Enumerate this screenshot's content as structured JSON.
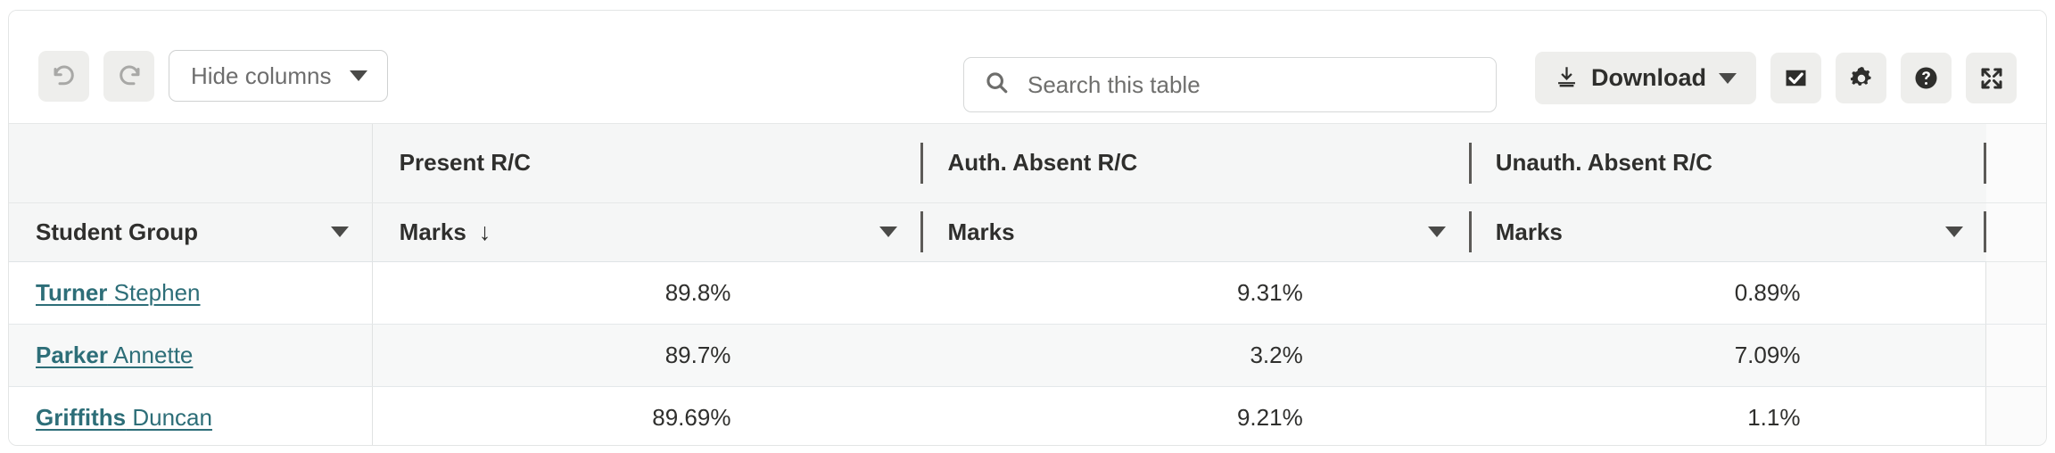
{
  "toolbar": {
    "undo_icon": "undo-arrow-icon",
    "redo_icon": "redo-arrow-icon",
    "hide_columns_label": "Hide columns",
    "search_placeholder": "Search this table",
    "search_value": "",
    "search_icon": "search-icon",
    "download_label": "Download",
    "download_icon": "download-icon",
    "select_icon": "checkbox-checked-icon",
    "settings_icon": "gear-icon",
    "help_icon": "question-circle-icon",
    "fullscreen_icon": "expand-arrows-icon"
  },
  "table": {
    "group_headers": [
      {
        "label": ""
      },
      {
        "label": "Present R/C"
      },
      {
        "label": "Auth. Absent R/C"
      },
      {
        "label": "Unauth. Absent R/C"
      }
    ],
    "sub_headers": [
      {
        "label": "Student Group",
        "sort": "",
        "caret": true
      },
      {
        "label": "Marks",
        "sort": "↓",
        "caret": false
      },
      {
        "label": "Marks",
        "sort": "",
        "caret": true
      },
      {
        "label": "Marks",
        "sort": "",
        "caret": true
      }
    ],
    "rows": [
      {
        "surname": "Turner",
        "given": " Stephen",
        "present": "89.8%",
        "auth_absent": "9.31%",
        "unauth_absent": "0.89%"
      },
      {
        "surname": "Parker",
        "given": " Annette",
        "present": "89.7%",
        "auth_absent": "3.2%",
        "unauth_absent": "7.09%"
      },
      {
        "surname": "Griffiths",
        "given": " Duncan",
        "present": "89.69%",
        "auth_absent": "9.21%",
        "unauth_absent": "1.1%"
      }
    ]
  },
  "colors": {
    "link": "#2d6e78",
    "header_bg": "#f5f6f6",
    "row_alt_bg": "#f7f8f8",
    "button_bg": "#eeeeec",
    "border": "#e3e5e5"
  }
}
